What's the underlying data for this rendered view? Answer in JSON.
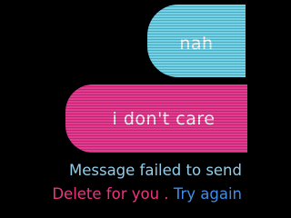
{
  "messages": [
    {
      "text": "nah",
      "color": "#6fd4ea"
    },
    {
      "text": "i don't care",
      "color": "#e6398f"
    }
  ],
  "status": {
    "failed_text": "Message failed to send",
    "delete_label": "Delete for you",
    "separator": " . ",
    "retry_label": "Try again",
    "delete_color": "#e8367f",
    "retry_color": "#3d8ee8",
    "failed_color": "#92cde8"
  }
}
